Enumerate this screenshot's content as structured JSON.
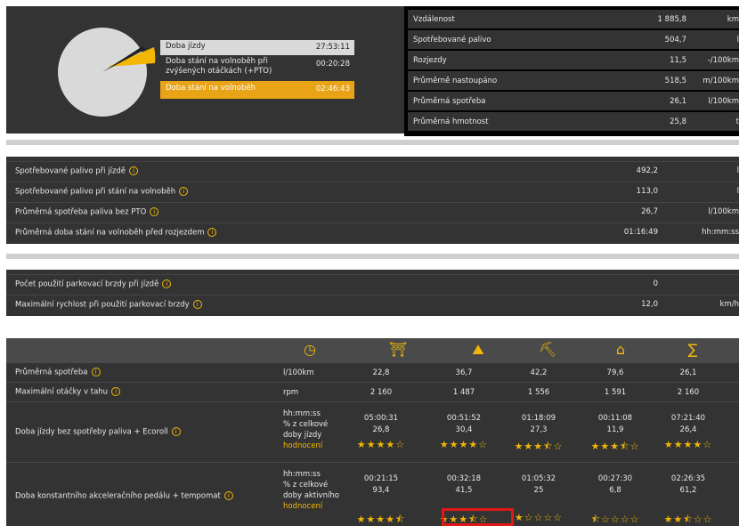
{
  "summary": {
    "legend": [
      {
        "label": "Doba jízdy",
        "value": "27:53:11"
      },
      {
        "label": "Doba stání na volnoběh při zvýšených otáčkách (+PTO)",
        "value": "00:20:28"
      },
      {
        "label": "Doba stání na volnoběh",
        "value": "02:46:43"
      }
    ],
    "colors": {
      "driving": "#d9d9d9",
      "pto": "#222222",
      "idle": "#f2b705"
    }
  },
  "stats": [
    {
      "label": "Vzdálenost",
      "value": "1 885,8",
      "unit": "km"
    },
    {
      "label": "Spotřebované palivo",
      "value": "504,7",
      "unit": "l"
    },
    {
      "label": "Rozjezdy",
      "value": "11,5",
      "unit": "-/100km"
    },
    {
      "label": "Průměrně nastoupáno",
      "value": "518,5",
      "unit": "m/100km"
    },
    {
      "label": "Průměrná spotřeba",
      "value": "26,1",
      "unit": "l/100km"
    },
    {
      "label": "Průměrná hmotnost",
      "value": "25,8",
      "unit": "t"
    }
  ],
  "fuel": [
    {
      "label": "Spotřebované palivo při jízdě",
      "value": "492,2",
      "unit": "l"
    },
    {
      "label": "Spotřebované palivo při stání na volnoběh",
      "value": "113,0",
      "unit": "l"
    },
    {
      "label": "Průměrná spotřeba paliva bez PTO",
      "value": "26,7",
      "unit": "l/100km"
    },
    {
      "label": "Průměrná doba stání na volnoběh před rozjezdem",
      "value": "01:16:49",
      "unit": "hh:mm:ss"
    }
  ],
  "brake": [
    {
      "label": "Počet použití parkovací brzdy při jízdě",
      "value": "0",
      "unit": ""
    },
    {
      "label": "Maximální rychlost při použití parkovací brzdy",
      "value": "12,0",
      "unit": "km/h"
    }
  ],
  "table": {
    "header_icons": [
      "stopwatch-icon",
      "flat-road-icon",
      "hilly-road-icon",
      "mountain-road-icon",
      "city-icon",
      "sum-icon"
    ],
    "header_glyphs": [
      "◷",
      "⛩",
      "⛰",
      "⛏",
      "⌂",
      "∑"
    ],
    "rows": [
      {
        "name": "Průměrná spotřeba",
        "unit": "l/100km",
        "values": [
          "22,8",
          "36,7",
          "42,2",
          "79,6",
          "26,1"
        ]
      },
      {
        "name": "Maximální otáčky v tahu",
        "unit": "rpm",
        "values": [
          "2 160",
          "1 487",
          "1 556",
          "1 591",
          "2 160"
        ]
      },
      {
        "name": "Doba jízdy bez spotřeby paliva + Ecoroll",
        "unit_lines": [
          "hh:mm:ss",
          "% z celkové",
          "doby jízdy",
          "hodnocení"
        ],
        "times": [
          "05:00:31",
          "00:51:52",
          "01:18:09",
          "00:11:08",
          "07:21:40"
        ],
        "percents": [
          "26,8",
          "30,4",
          "27,3",
          "11,9",
          "26,4"
        ],
        "ratings": [
          4,
          4,
          3.5,
          3.5,
          4
        ]
      },
      {
        "name": "Doba konstantního akceleračního pedálu + tempomat",
        "unit_lines": [
          "hh:mm:ss",
          "% z celkové",
          "doby aktivního",
          "hodnocení"
        ],
        "times": [
          "00:21:15",
          "00:32:18",
          "01:05:32",
          "00:27:30",
          "02:26:35"
        ],
        "percents": [
          "93,4",
          "41,5",
          "25",
          "6,8",
          "61,2"
        ],
        "ratings": [
          4.5,
          3.5,
          1,
          0.5,
          2.5
        ]
      }
    ]
  },
  "highlight_color": "#e01818"
}
